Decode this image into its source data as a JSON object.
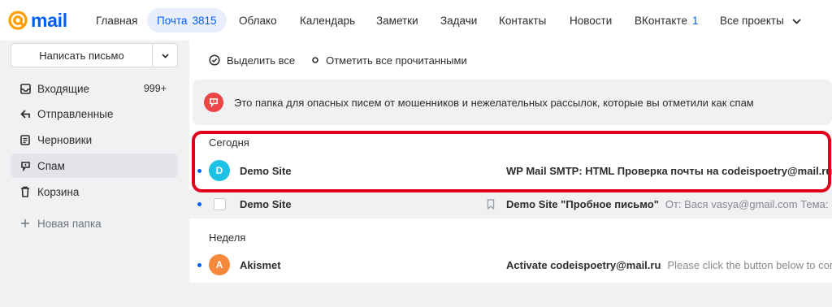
{
  "logo": {
    "text": "mail"
  },
  "nav": {
    "items": [
      {
        "label": "Главная"
      },
      {
        "label": "Почта",
        "count": "3815"
      },
      {
        "label": "Облако"
      },
      {
        "label": "Календарь"
      },
      {
        "label": "Заметки"
      },
      {
        "label": "Задачи"
      },
      {
        "label": "Контакты"
      },
      {
        "label": "Новости"
      },
      {
        "label": "ВКонтакте",
        "count": "1"
      },
      {
        "label": "Все проекты"
      }
    ]
  },
  "sidebar": {
    "compose_label": "Написать письмо",
    "items": [
      {
        "label": "Входящие",
        "count": "999+",
        "icon": "inbox-icon"
      },
      {
        "label": "Отправленные",
        "icon": "sent-icon"
      },
      {
        "label": "Черновики",
        "icon": "drafts-icon"
      },
      {
        "label": "Спам",
        "icon": "spam-icon"
      },
      {
        "label": "Корзина",
        "icon": "trash-icon"
      },
      {
        "label": "Новая папка",
        "icon": "plus-icon"
      }
    ]
  },
  "toolbar": {
    "select_all": "Выделить все",
    "mark_read": "Отметить все прочитанными"
  },
  "banner": {
    "text": "Это папка для опасных писем от мошенников и нежелательных рассылок, которые вы отметили как спам"
  },
  "groups": {
    "today": "Сегодня",
    "week": "Неделя"
  },
  "messages": [
    {
      "avatar": "D",
      "sender": "Demo Site",
      "subject": "WP Mail SMTP: HTML Проверка почты на codeispoetry@mail.ru",
      "snippet": ""
    },
    {
      "sender": "Demo Site",
      "subject": "Demo Site \"Пробное письмо\"",
      "snippet": "От: Вася vasya@gmail.com Тема: П"
    },
    {
      "avatar": "A",
      "sender": "Akismet",
      "subject": "Activate codeispoetry@mail.ru",
      "snippet": "Please click the button below to con"
    }
  ],
  "colors": {
    "accent": "#005ff9",
    "spam": "#ed4545",
    "avatar_d": "#1ec1e6",
    "avatar_a": "#f5883d",
    "highlight": "#e3001b"
  }
}
